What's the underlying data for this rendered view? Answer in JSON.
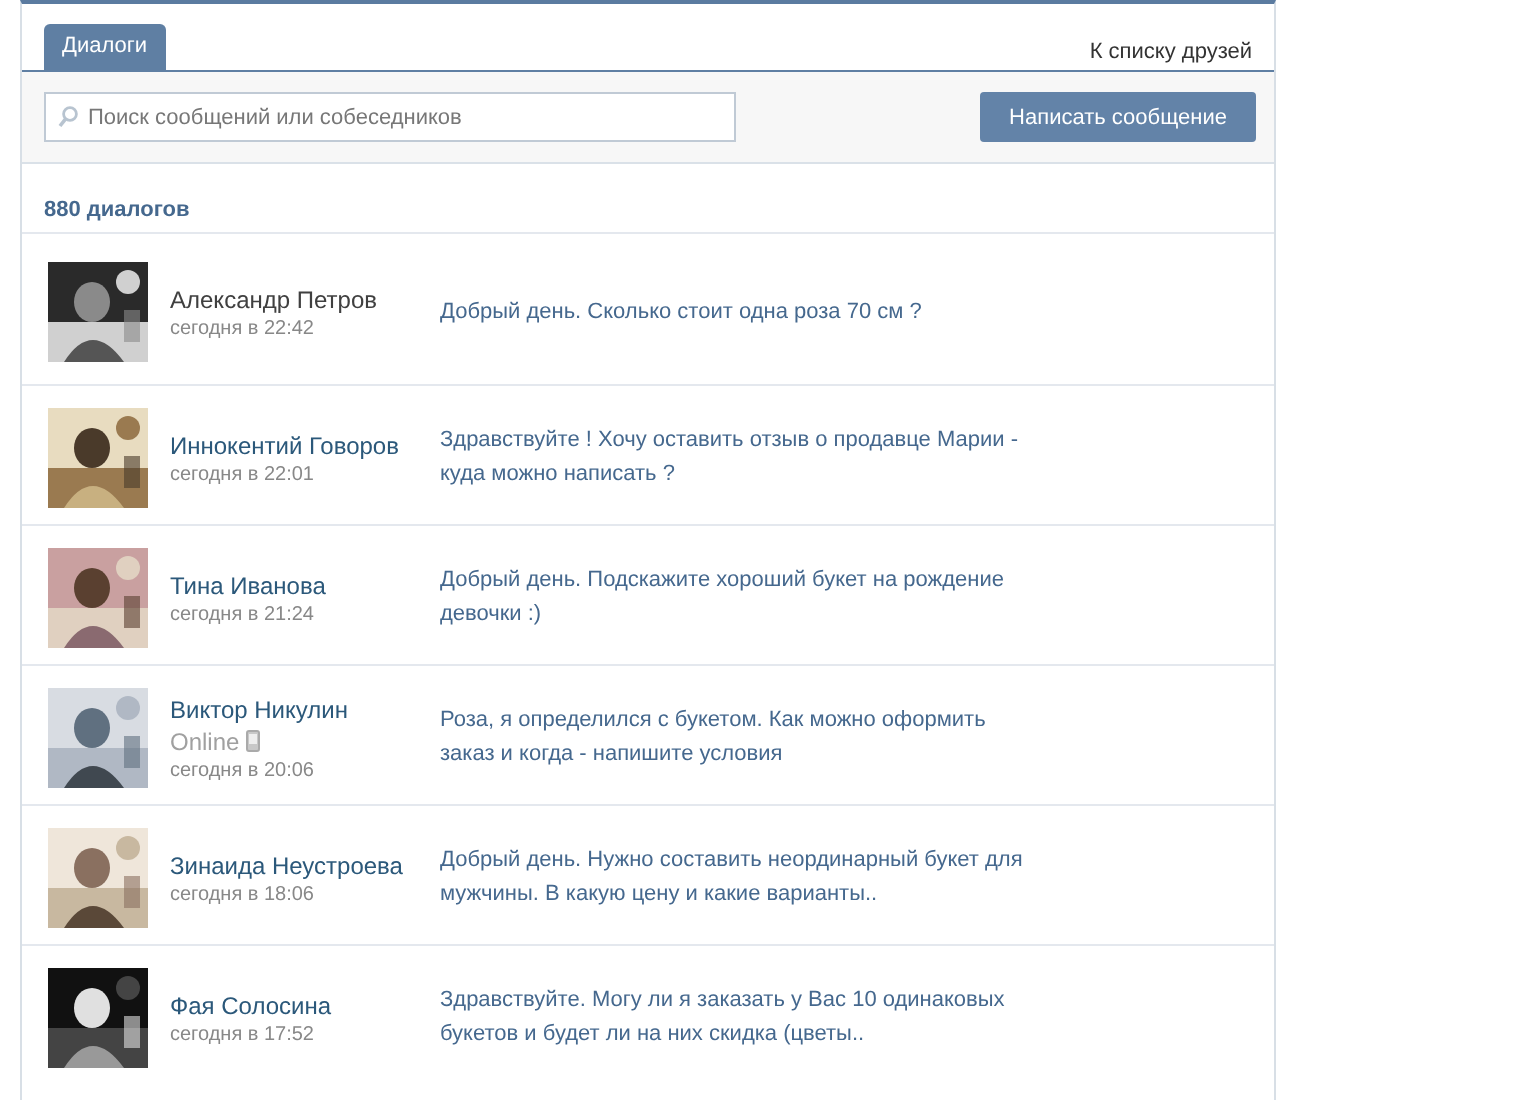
{
  "tabs": [
    {
      "label": "Диалоги",
      "selected": true
    }
  ],
  "friends_link": "К списку друзей",
  "search": {
    "placeholder": "Поиск сообщений или собеседников"
  },
  "compose_button": "Написать сообщение",
  "count": "880 диалогов",
  "dialogs": [
    {
      "name": "Александр Петров",
      "time": "сегодня в 22:42",
      "message": "Добрый день. Сколько стоит одна роза 70 см ?"
    },
    {
      "name": "Иннокентий Говоров",
      "time": "сегодня в 22:01",
      "message": "Здравствуйте ! Хочу оставить отзыв о продавце Марии - куда можно написать ?"
    },
    {
      "name": "Тина Иванова",
      "time": "сегодня в 21:24",
      "message": "Добрый день. Подскажите хороший букет на рождение девочки :)"
    },
    {
      "name": "Виктор Никулин",
      "status": "Online",
      "mobile": true,
      "time": "сегодня в 20:06",
      "message": "Роза, я определился с букетом. Как можно оформить заказ и когда - напишите условия"
    },
    {
      "name": "Зинаида Неустроева",
      "time": "сегодня в 18:06",
      "message": "Добрый день. Нужно составить неординарный букет для мужчины. В какую цену и какие варианты.."
    },
    {
      "name": "Фая Солосина",
      "time": "сегодня в 17:52",
      "message": "Здравствуйте. Могу ли я заказать у Вас 10 одинаковых букетов и будет ли на них скидка (цветы.."
    }
  ]
}
